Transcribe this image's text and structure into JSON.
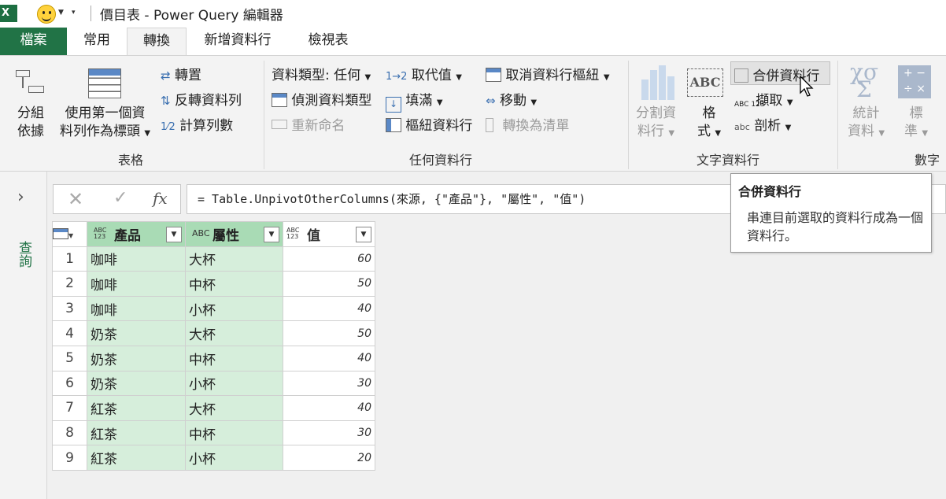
{
  "window": {
    "title": "價目表 - Power Query 編輯器"
  },
  "tabs": [
    {
      "label": "檔案"
    },
    {
      "label": "常用"
    },
    {
      "label": "轉換"
    },
    {
      "label": "新增資料行"
    },
    {
      "label": "檢視表"
    }
  ],
  "ribbon": {
    "table_group": {
      "label": "表格",
      "group_by": {
        "line1": "分組",
        "line2": "依據"
      },
      "use_first_row": {
        "line1": "使用第一個資",
        "line2": "料列作為標頭"
      },
      "transpose": "轉置",
      "reverse_rows": "反轉資料列",
      "count_rows": "計算列數"
    },
    "any_column_group": {
      "label": "任何資料行",
      "data_type": "資料類型: 任何",
      "detect_type": "偵測資料類型",
      "rename": "重新命名",
      "replace_values": "取代值",
      "fill": "填滿",
      "pivot": "樞紐資料行",
      "unpivot": "取消資料行樞紐",
      "move": "移動",
      "convert_to_list": "轉換為清單"
    },
    "text_column_group": {
      "label": "文字資料行",
      "split": {
        "line1": "分割資",
        "line2": "料行"
      },
      "format": {
        "line1": "格",
        "line2": "式"
      },
      "merge": "合併資料行",
      "extract": "擷取",
      "parse": "剖析"
    },
    "number_column_group": {
      "label": "數字",
      "statistics": {
        "line1": "統計",
        "line2": "資料"
      },
      "standard": {
        "line1": "標",
        "line2": "準"
      }
    }
  },
  "left_pane": {
    "label": "查詢"
  },
  "formula_bar": {
    "formula": "= Table.UnpivotOtherColumns(來源, {\"產品\"}, \"屬性\", \"值\")"
  },
  "grid": {
    "columns": [
      {
        "name": "產品",
        "type": "ABC 123"
      },
      {
        "name": "屬性",
        "type": "ABC"
      },
      {
        "name": "值",
        "type": "ABC 123"
      }
    ],
    "rows": [
      {
        "n": "1",
        "product": "咖啡",
        "attr": "大杯",
        "value": "60"
      },
      {
        "n": "2",
        "product": "咖啡",
        "attr": "中杯",
        "value": "50"
      },
      {
        "n": "3",
        "product": "咖啡",
        "attr": "小杯",
        "value": "40"
      },
      {
        "n": "4",
        "product": "奶茶",
        "attr": "大杯",
        "value": "50"
      },
      {
        "n": "5",
        "product": "奶茶",
        "attr": "中杯",
        "value": "40"
      },
      {
        "n": "6",
        "product": "奶茶",
        "attr": "小杯",
        "value": "30"
      },
      {
        "n": "7",
        "product": "紅茶",
        "attr": "大杯",
        "value": "40"
      },
      {
        "n": "8",
        "product": "紅茶",
        "attr": "中杯",
        "value": "30"
      },
      {
        "n": "9",
        "product": "紅茶",
        "attr": "小杯",
        "value": "20"
      }
    ]
  },
  "tooltip": {
    "title": "合併資料行",
    "description": "串連目前選取的資料行成為一個資料行。"
  },
  "colors": {
    "accent": "#217346",
    "selected_column": "#d6eedb",
    "selected_header": "#a9dbb5"
  }
}
